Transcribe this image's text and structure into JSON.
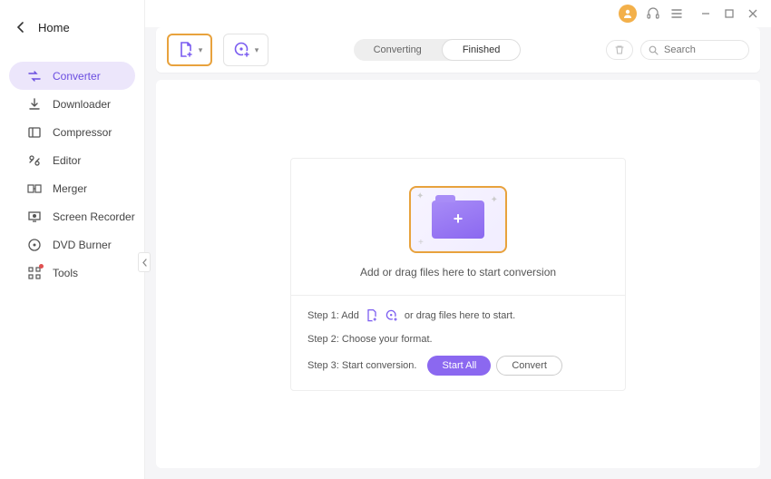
{
  "home_label": "Home",
  "sidebar": {
    "items": [
      {
        "label": "Converter"
      },
      {
        "label": "Downloader"
      },
      {
        "label": "Compressor"
      },
      {
        "label": "Editor"
      },
      {
        "label": "Merger"
      },
      {
        "label": "Screen Recorder"
      },
      {
        "label": "DVD Burner"
      },
      {
        "label": "Tools"
      }
    ]
  },
  "tabs": {
    "converting": "Converting",
    "finished": "Finished"
  },
  "search": {
    "placeholder": "Search"
  },
  "drop": {
    "main_text": "Add or drag files here to start conversion",
    "step1_a": "Step 1: Add",
    "step1_b": "or drag files here to start.",
    "step2": "Step 2: Choose your format.",
    "step3": "Step 3: Start conversion.",
    "start_all": "Start All",
    "convert": "Convert"
  }
}
